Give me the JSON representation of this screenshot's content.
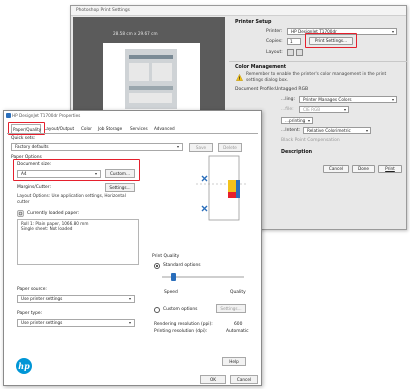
{
  "photoshop": {
    "title": "Photoshop Print Settings",
    "preview_size": "28.58 cm x 29.67 cm",
    "printer_setup": {
      "heading": "Printer Setup",
      "printer_label": "Printer:",
      "printer_value": "HP DesignJet T1700dr",
      "copies_label": "Copies:",
      "copies_value": "1",
      "print_settings_button": "Print Settings...",
      "layout_label": "Layout:"
    },
    "color_management": {
      "heading": "Color Management",
      "warning_text": "Remember to enable the printer's color management in the print settings dialog box.",
      "doc_profile_label": "Document Profile:",
      "doc_profile_value": "Untagged RGB",
      "color_handling_label": "...ling:",
      "color_handling_value": "Printer Manages Colors",
      "printer_profile_label": "...file:",
      "printer_profile_value": "CIE RGB",
      "normal_printing": "...printing",
      "rendering_intent_label": "...Intent:",
      "rendering_intent_value": "Relative Colorimetric",
      "black_point": "Black Point Compensation",
      "description": "Description"
    },
    "buttons": {
      "cancel": "Cancel",
      "done": "Done",
      "print": "Print"
    }
  },
  "hp_dialog": {
    "title": "HP DesignJet T1700dr Properties",
    "tabs": [
      "Paper/Quality",
      "Layout/Output",
      "Color",
      "Job Storage",
      "Services",
      "Advanced"
    ],
    "quick_sets_label": "Quick sets:",
    "quick_sets_value": "Factory defaults",
    "save_button": "Save",
    "delete_button": "Delete",
    "paper_options_label": "Paper Options",
    "document_size_label": "Document size:",
    "document_size_value": "A4",
    "custom_button": "Custom...",
    "margins_label": "Margins/Cutter:",
    "settings_button": "Settings...",
    "layout_options_text": "Layout Options: Use application settings, Horizontal cutter",
    "currently_loaded_label": "Currently loaded paper:",
    "loaded_paper_text": "Roll 1: Plain paper, 1066.80 mm",
    "loaded_paper_text2": "Single sheet: Not loaded",
    "paper_source_label": "Paper source:",
    "paper_source_value": "Use printer settings",
    "paper_type_label": "Paper type:",
    "paper_type_value": "Use printer settings",
    "print_quality_label": "Print Quality",
    "standard_options": "Standard options",
    "speed_label": "Speed",
    "quality_label": "Quality",
    "custom_options": "Custom options",
    "pq_settings_button": "Settings...",
    "rendering_resolution_label": "Rendering resolution (ppi):",
    "rendering_resolution_value": "600",
    "printing_resolution_label": "Printing resolution (dpi):",
    "printing_resolution_value": "Automatic",
    "help_button": "Help",
    "ok_button": "OK",
    "cancel_button": "Cancel",
    "logo_text": "hp"
  },
  "colors": {
    "highlight": "#e5202d",
    "accent": "#2a6ebb",
    "hp_blue": "#0096d6"
  }
}
